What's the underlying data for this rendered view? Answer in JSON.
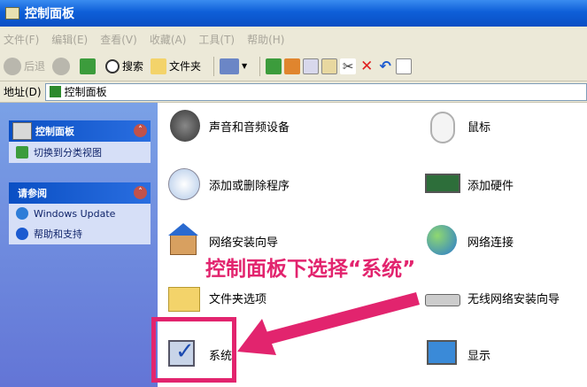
{
  "window": {
    "title": "控制面板"
  },
  "menu": [
    "文件(F)",
    "编辑(E)",
    "查看(V)",
    "收藏(A)",
    "工具(T)",
    "帮助(H)"
  ],
  "toolbar": {
    "back": "后退",
    "search": "搜索",
    "folders": "文件夹"
  },
  "address": {
    "label": "地址(D)",
    "value": "控制面板"
  },
  "sidebar": {
    "panel1": {
      "title": "控制面板",
      "items": [
        "切换到分类视图"
      ]
    },
    "panel2": {
      "title": "请参阅",
      "items": [
        "Windows Update",
        "帮助和支持"
      ]
    }
  },
  "items": [
    {
      "label": "声音和音频设备",
      "icon": "speaker-icon"
    },
    {
      "label": "鼠标",
      "icon": "mouse-icon"
    },
    {
      "label": "添加或删除程序",
      "icon": "add-remove-programs-icon"
    },
    {
      "label": "添加硬件",
      "icon": "add-hardware-icon"
    },
    {
      "label": "网络安装向导",
      "icon": "network-setup-icon"
    },
    {
      "label": "网络连接",
      "icon": "network-connections-icon"
    },
    {
      "label": "文件夹选项",
      "icon": "folder-options-icon"
    },
    {
      "label": "无线网络安装向导",
      "icon": "wireless-setup-icon"
    },
    {
      "label": "系统",
      "icon": "system-icon"
    },
    {
      "label": "显示",
      "icon": "display-icon"
    }
  ],
  "annotation": {
    "text": "控制面板下选择“系统”",
    "color": "#e2246e"
  }
}
